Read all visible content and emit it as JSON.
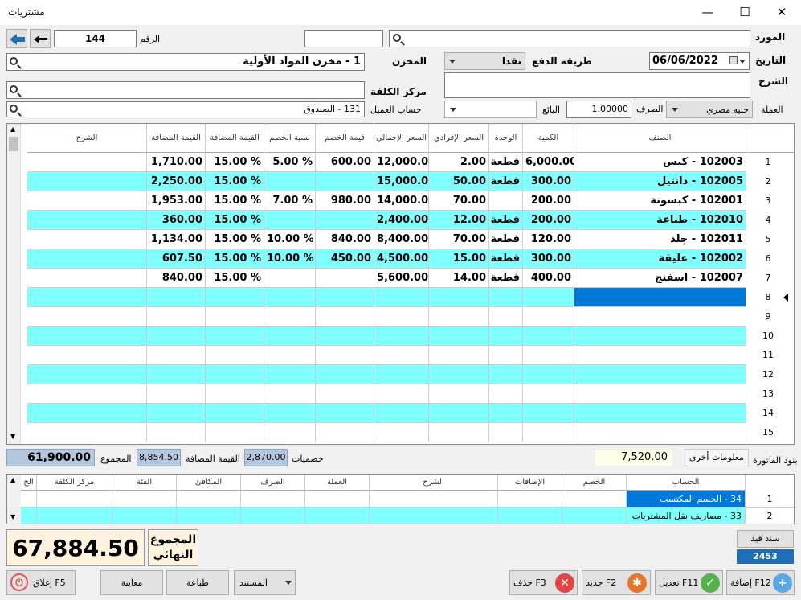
{
  "window": {
    "title": "مشتريات",
    "minimize": "—",
    "maximize": "☐",
    "close": "✕"
  },
  "header": {
    "number_label": "الرقم",
    "number_value": "144",
    "supplier_label": "المورد",
    "supplier_value": "",
    "supplier_code": "",
    "store_label": "المخزن",
    "store_value": "1 - مخزن المواد الأولية",
    "payment_label": "طريقة الدفع",
    "payment_value": "نقدا",
    "date_label": "التاريخ",
    "date_value": "06/06/2022",
    "cost_center_label": "مركز الكلفة",
    "cost_center_value": "",
    "notes_label": "الشرح",
    "notes_value": "",
    "client_account_label": "حساب العميل",
    "client_account_value": "131 - الصندوق",
    "seller_label": "البائع",
    "seller_value": "",
    "exchange_label": "الصرف",
    "exchange_value": "1.00000",
    "currency_label": "العملة",
    "currency_value": "جنيه مصري"
  },
  "grid": {
    "columns": [
      "الصنف",
      "الكمية",
      "الوحدة",
      "السعر الإفرادي",
      "السعر الإجمالي",
      "قيمة الخصم",
      "نسبة الخصم",
      "القيمة المضافة",
      "القيمة المضافة",
      "الشرح"
    ],
    "rows": [
      {
        "n": "1",
        "item": "102003 - كيس",
        "qty": "6,000.00",
        "unit": "قطعة",
        "price": "2.00",
        "total": "12,000.00",
        "disc_val": "600.00",
        "disc_pct": "5.00 %",
        "vat_pct": "15.00 %",
        "vat_val": "1,710.00",
        "note": ""
      },
      {
        "n": "2",
        "item": "102005 - دانتيل",
        "qty": "300.00",
        "unit": "قطعة",
        "price": "50.00",
        "total": "15,000.00",
        "disc_val": "",
        "disc_pct": "",
        "vat_pct": "15.00 %",
        "vat_val": "2,250.00",
        "note": ""
      },
      {
        "n": "3",
        "item": "102001 - كبسونة",
        "qty": "200.00",
        "unit": "",
        "price": "70.00",
        "total": "14,000.00",
        "disc_val": "980.00",
        "disc_pct": "7.00 %",
        "vat_pct": "15.00 %",
        "vat_val": "1,953.00",
        "note": ""
      },
      {
        "n": "4",
        "item": "102010 - طباعة",
        "qty": "200.00",
        "unit": "قطعة",
        "price": "12.00",
        "total": "2,400.00",
        "disc_val": "",
        "disc_pct": "",
        "vat_pct": "15.00 %",
        "vat_val": "360.00",
        "note": ""
      },
      {
        "n": "5",
        "item": "102011 - جلد",
        "qty": "120.00",
        "unit": "قطعة",
        "price": "70.00",
        "total": "8,400.00",
        "disc_val": "840.00",
        "disc_pct": "10.00 %",
        "vat_pct": "15.00 %",
        "vat_val": "1,134.00",
        "note": ""
      },
      {
        "n": "6",
        "item": "102002 - عليقة",
        "qty": "300.00",
        "unit": "قطعة",
        "price": "15.00",
        "total": "4,500.00",
        "disc_val": "450.00",
        "disc_pct": "10.00 %",
        "vat_pct": "15.00 %",
        "vat_val": "607.50",
        "note": ""
      },
      {
        "n": "7",
        "item": "102007 - اسفنج",
        "qty": "400.00",
        "unit": "قطعة",
        "price": "14.00",
        "total": "5,600.00",
        "disc_val": "",
        "disc_pct": "",
        "vat_pct": "15.00 %",
        "vat_val": "840.00",
        "note": ""
      }
    ],
    "empty_row_numbers": [
      "8",
      "9",
      "10",
      "11",
      "12",
      "13",
      "14",
      "15"
    ],
    "row_color": "#80ffff",
    "selected_color": "#0078d7"
  },
  "totals": {
    "invoice_items_label": "بنود الفاتورة",
    "other_info_label": "معلومات أخرى",
    "other_info_value": "7,520.00",
    "discounts_label": "خصميات",
    "discounts_value": "2,870.00",
    "vat_label": "القيمة المضافة",
    "vat_value": "8,854.50",
    "sum_label": "المجموع",
    "sum_value": "61,900.00",
    "final_label_1": "المجموع",
    "final_label_2": "النهائي",
    "final_value": "67,884.50"
  },
  "accounts_grid": {
    "columns": [
      "الحساب",
      "الخصم",
      "الإضافات",
      "الشرح",
      "العملة",
      "الصرف",
      "المكافئ",
      "الفئة",
      "مركز الكلفة",
      "الح"
    ],
    "rows": [
      {
        "n": "1",
        "account": "34 - الحسم المكتسب"
      },
      {
        "n": "2",
        "account": "33 - مصاريف نقل المشتريات"
      }
    ]
  },
  "journal": {
    "label": "سند قيد",
    "value": "2453"
  },
  "buttons": {
    "add": "إضافة F12",
    "edit": "تعديل F11",
    "new": "جديد F2",
    "delete": "حذف F3",
    "document": "المستند",
    "print": "طباعة",
    "preview": "معاينة",
    "close": "إغلاق F5"
  }
}
